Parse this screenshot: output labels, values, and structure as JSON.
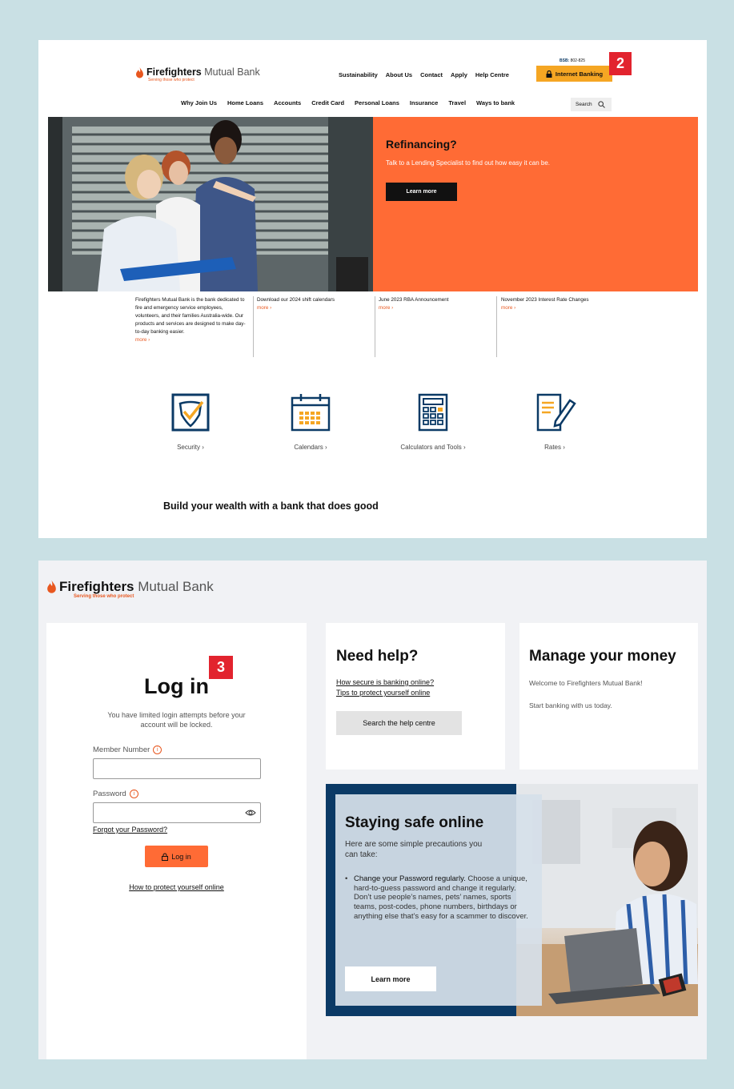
{
  "colors": {
    "background": "#c9e0e4",
    "accent_orange": "#ff6b35",
    "ib_yellow": "#f5a623",
    "navy": "#0b3a66",
    "badge_red": "#e2232e"
  },
  "brand": {
    "name_bold": "Firefighters",
    "name_rest": "Mutual Bank",
    "tagline": "Serving those who protect"
  },
  "panel1": {
    "top_nav": [
      "Sustainability",
      "About Us",
      "Contact",
      "Apply",
      "Help Centre"
    ],
    "bsb_label": "BSB:",
    "bsb_value": "802-825",
    "internet_banking": "Internet Banking",
    "badge": "2",
    "main_nav": [
      "Why Join Us",
      "Home Loans",
      "Accounts",
      "Credit Card",
      "Personal Loans",
      "Insurance",
      "Travel",
      "Ways to bank"
    ],
    "search_label": "Search",
    "hero": {
      "title": "Refinancing?",
      "text": "Talk to a Lending Specialist to find out how easy it can be.",
      "button": "Learn more"
    },
    "news": [
      {
        "text": "Firefighters Mutual Bank is the bank dedicated to fire and emergency service employees, volunteers, and their families Australia-wide. Our products and services are designed to make day-to-day banking easier.",
        "more": "more ›"
      },
      {
        "text": "Download our 2024 shift calendars",
        "more": "more ›"
      },
      {
        "text": "June 2023 RBA Announcement",
        "more": "more ›"
      },
      {
        "text": "November 2023 Interest Rate Changes",
        "more": "more ›"
      }
    ],
    "tools": [
      {
        "label": "Security ›",
        "icon": "shield-icon"
      },
      {
        "label": "Calendars ›",
        "icon": "calendar-icon"
      },
      {
        "label": "Calculators and Tools ›",
        "icon": "calculator-icon"
      },
      {
        "label": "Rates ›",
        "icon": "document-pen-icon"
      }
    ],
    "heading": "Build your wealth with a bank that does good"
  },
  "panel2": {
    "login": {
      "title": "Log in",
      "badge": "3",
      "note": "You have limited login attempts before your account will be locked.",
      "member_label": "Member Number",
      "member_value": "",
      "password_label": "Password",
      "password_value": "",
      "forgot": "Forgot your Password?",
      "button": "Log in",
      "protect_link": "How to protect yourself online"
    },
    "help": {
      "title": "Need help?",
      "link1": "How secure is banking online?",
      "link2": "Tips to protect yourself online",
      "button": "Search the help centre"
    },
    "money": {
      "title": "Manage your money",
      "line1": "Welcome to Firefighters Mutual Bank!",
      "line2": "Start banking with us today."
    },
    "safe": {
      "title": "Staying safe online",
      "intro": "Here are some simple precautions you can take:",
      "bullet_title": "Change your Password regularly.",
      "bullet_text": "Choose a unique, hard-to-guess password and change it regularly. Don’t use people’s names, pets’ names, sports teams, post-codes, phone numbers, birthdays or anything else that’s easy for a scammer to discover.",
      "button": "Learn more"
    }
  }
}
